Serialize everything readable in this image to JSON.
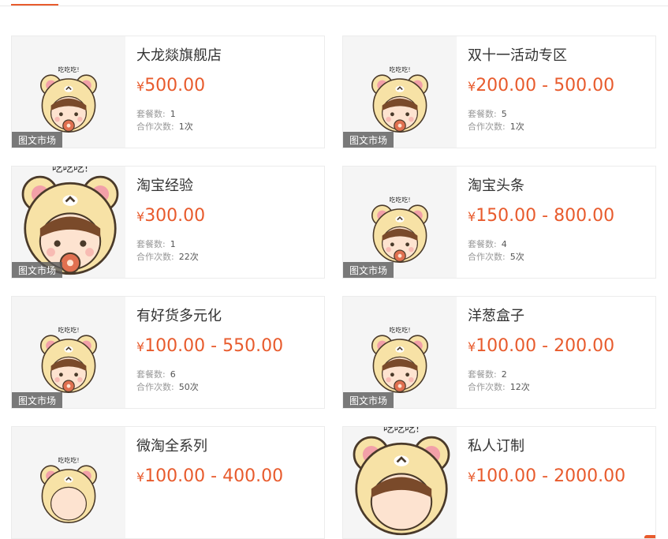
{
  "tag_label": "图文市场",
  "meta_labels": {
    "combos": "套餐数:",
    "coop": "合作次数:"
  },
  "currency": "¥",
  "accent_color": "#e85b2d",
  "cards": [
    {
      "name": "大龙燚旗舰店",
      "price": "500.00",
      "combos": "1",
      "coop": "1次",
      "image": "bear-girl-small"
    },
    {
      "name": "双十一活动专区",
      "price": "200.00 - 500.00",
      "combos": "5",
      "coop": "1次",
      "image": "bear-girl-small"
    },
    {
      "name": "淘宝经验",
      "price": "300.00",
      "combos": "1",
      "coop": "22次",
      "image": "bear-girl-large"
    },
    {
      "name": "淘宝头条",
      "price": "150.00 - 800.00",
      "combos": "4",
      "coop": "5次",
      "image": "bear-girl-small"
    },
    {
      "name": "有好货多元化",
      "price": "100.00 - 550.00",
      "combos": "6",
      "coop": "50次",
      "image": "bear-girl-small"
    },
    {
      "name": "洋葱盒子",
      "price": "100.00 - 200.00",
      "combos": "2",
      "coop": "12次",
      "image": "bear-girl-small"
    },
    {
      "name": "微淘全系列",
      "price": "100.00 - 400.00",
      "combos": "",
      "coop": "",
      "image": "bear-girl-small"
    },
    {
      "name": "私人订制",
      "price": "100.00 - 2000.00",
      "combos": "",
      "coop": "",
      "image": "bear-girl-large"
    }
  ]
}
